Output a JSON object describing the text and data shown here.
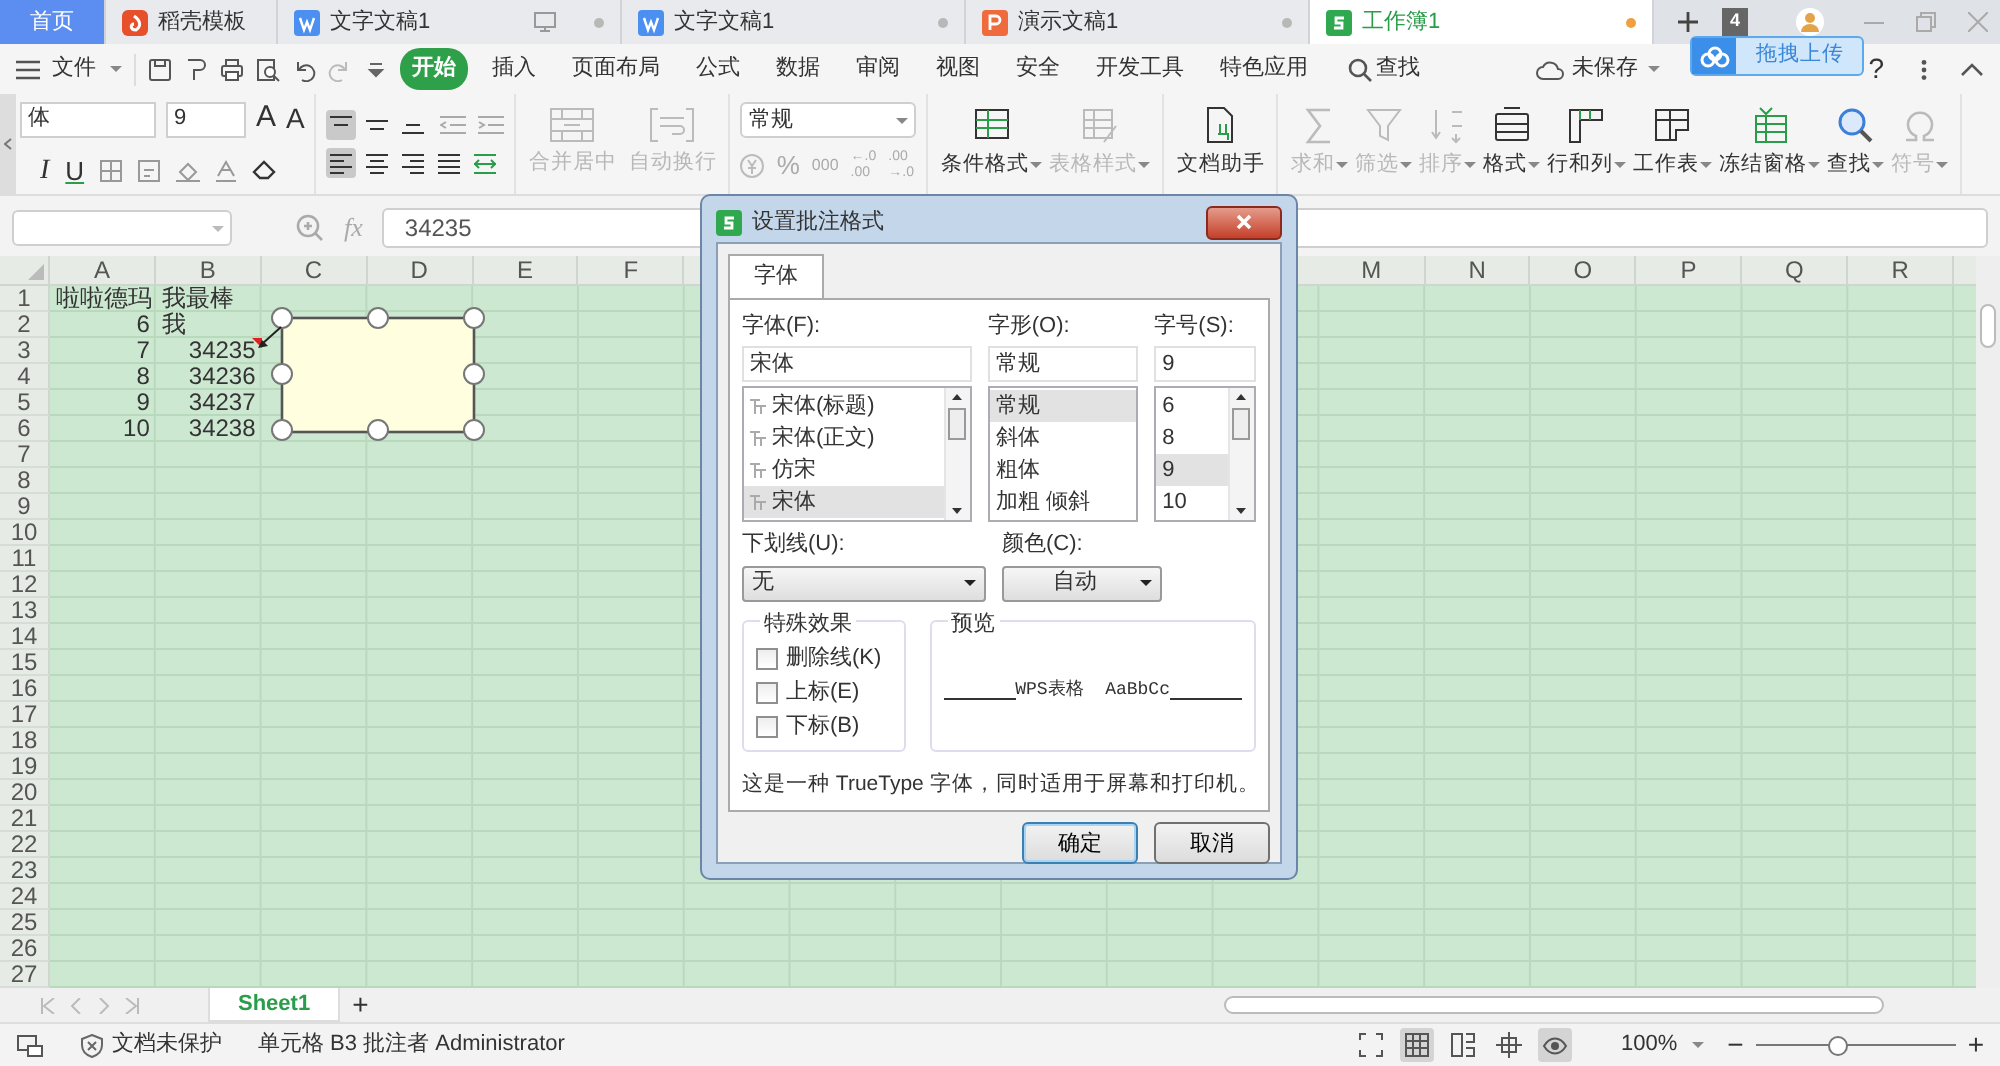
{
  "tabs": [
    {
      "label": "首页",
      "kind": "home",
      "selected": false
    },
    {
      "label": "稻壳模板",
      "kind": "docer",
      "selected": false
    },
    {
      "label": "文字文稿1",
      "kind": "writer",
      "selected": false,
      "color": "#b8b8b8"
    },
    {
      "label": "文字文稿1",
      "kind": "writer",
      "selected": false,
      "color": "#b8b8b8"
    },
    {
      "label": "演示文稿1",
      "kind": "presentation",
      "selected": false,
      "color": "#b8b8b8"
    },
    {
      "label": "工作簿1",
      "kind": "sheet",
      "selected": true,
      "color": "#f0a040"
    }
  ],
  "tab_count": "4",
  "upload_popup": "拖拽上传",
  "menu": {
    "file": "文件",
    "tabs": [
      {
        "label": "开始",
        "selected": true
      },
      {
        "label": "插入",
        "selected": false
      },
      {
        "label": "页面布局",
        "selected": false
      },
      {
        "label": "公式",
        "selected": false
      },
      {
        "label": "数据",
        "selected": false
      },
      {
        "label": "审阅",
        "selected": false
      },
      {
        "label": "视图",
        "selected": false
      },
      {
        "label": "安全",
        "selected": false
      },
      {
        "label": "开发工具",
        "selected": false
      },
      {
        "label": "特色应用",
        "selected": false
      }
    ],
    "search": "查找",
    "save_state": "未保存",
    "help": "?"
  },
  "ribbon": {
    "font_name": "体",
    "font_size": "9",
    "grow": "A",
    "shrink": "A",
    "italic": "I",
    "underline": "U",
    "vertical_align": [
      {
        "selected": true
      },
      {
        "selected": false
      },
      {
        "selected": false
      }
    ],
    "horizontal_align": [
      {
        "selected": true
      },
      {
        "selected": false
      },
      {
        "selected": false
      },
      {
        "selected": false
      },
      {
        "selected": false
      }
    ],
    "merge": {
      "label": "合并居中",
      "disabled": true
    },
    "wrap": {
      "label": "自动换行",
      "disabled": true
    },
    "number_format": "常规",
    "percent": "%",
    "thousands": "000",
    "decimals": [
      {
        "top": "←.0",
        "bottom": ".00"
      },
      {
        "top": ".00",
        "bottom": "→.0"
      }
    ],
    "big_buttons": [
      {
        "label": "条件格式",
        "disabled": false,
        "menu": true
      },
      {
        "label": "表格样式",
        "disabled": true,
        "menu": true
      },
      {
        "label": "文档助手",
        "disabled": false,
        "menu": false
      },
      {
        "label": "求和",
        "disabled": true,
        "menu": true
      },
      {
        "label": "筛选",
        "disabled": true,
        "menu": true
      },
      {
        "label": "排序",
        "disabled": true,
        "menu": true
      },
      {
        "label": "格式",
        "disabled": false,
        "menu": true
      },
      {
        "label": "行和列",
        "disabled": false,
        "menu": true
      },
      {
        "label": "工作表",
        "disabled": false,
        "menu": true
      },
      {
        "label": "冻结窗格",
        "disabled": false,
        "menu": true
      },
      {
        "label": "查找",
        "disabled": false,
        "menu": true
      },
      {
        "label": "符号",
        "disabled": true,
        "menu": true
      }
    ]
  },
  "formula_bar": {
    "fx": "fx",
    "value": "34235"
  },
  "columns_left": [
    "A",
    "B",
    "C",
    "D",
    "E",
    "F"
  ],
  "columns_right": [
    "M",
    "N",
    "O",
    "P",
    "Q",
    "R"
  ],
  "rows": [
    {
      "label": "1",
      "cells": [
        {
          "text": "啦啦德玛",
          "kind": "text"
        },
        {
          "text": "我最棒",
          "kind": "text"
        }
      ]
    },
    {
      "label": "2",
      "cells": [
        {
          "text": "6",
          "kind": "number"
        },
        {
          "text": "我",
          "kind": "text"
        }
      ]
    },
    {
      "label": "3",
      "cells": [
        {
          "text": "7",
          "kind": "number"
        },
        {
          "text": "34235",
          "kind": "number",
          "comment": true
        }
      ]
    },
    {
      "label": "4",
      "cells": [
        {
          "text": "8",
          "kind": "number"
        },
        {
          "text": "34236",
          "kind": "number"
        }
      ]
    },
    {
      "label": "5",
      "cells": [
        {
          "text": "9",
          "kind": "number"
        },
        {
          "text": "34237",
          "kind": "number"
        }
      ]
    },
    {
      "label": "6",
      "cells": [
        {
          "text": "10",
          "kind": "number"
        },
        {
          "text": "34238",
          "kind": "number"
        }
      ]
    },
    {
      "label": "7"
    },
    {
      "label": "8"
    },
    {
      "label": "9"
    },
    {
      "label": "10"
    },
    {
      "label": "11"
    },
    {
      "label": "12"
    },
    {
      "label": "13"
    },
    {
      "label": "14"
    },
    {
      "label": "15"
    },
    {
      "label": "16"
    },
    {
      "label": "17"
    },
    {
      "label": "18"
    },
    {
      "label": "19"
    },
    {
      "label": "20"
    },
    {
      "label": "21"
    },
    {
      "label": "22"
    },
    {
      "label": "23"
    },
    {
      "label": "24"
    },
    {
      "label": "25"
    },
    {
      "label": "26"
    },
    {
      "label": "27"
    }
  ],
  "sheets": [
    {
      "label": "Sheet1",
      "selected": true
    }
  ],
  "add_sheet": "+",
  "dialog": {
    "title": "设置批注格式",
    "tabs": [
      {
        "label": "字体",
        "selected": true
      }
    ],
    "font": {
      "label": "字体(F):",
      "value": "宋体",
      "options": [
        {
          "label": "宋体(标题)",
          "selected": false
        },
        {
          "label": "宋体(正文)",
          "selected": false
        },
        {
          "label": "仿宋",
          "selected": false
        },
        {
          "label": "宋体",
          "selected": true
        }
      ]
    },
    "style": {
      "label": "字形(O):",
      "value": "常规",
      "options": [
        {
          "label": "常规",
          "selected": true
        },
        {
          "label": "斜体",
          "selected": false
        },
        {
          "label": "粗体",
          "selected": false
        },
        {
          "label": "加粗 倾斜",
          "selected": false
        }
      ]
    },
    "size": {
      "label": "字号(S):",
      "value": "9",
      "options": [
        {
          "label": "6",
          "selected": false
        },
        {
          "label": "8",
          "selected": false
        },
        {
          "label": "9",
          "selected": true
        },
        {
          "label": "10",
          "selected": false
        }
      ]
    },
    "underline": {
      "label": "下划线(U):",
      "value": "无"
    },
    "color": {
      "label": "颜色(C):",
      "value": "自动"
    },
    "effects": {
      "title": "特殊效果",
      "items": [
        {
          "label": "删除线(K)",
          "checked": false
        },
        {
          "label": "上标(E)",
          "checked": false
        },
        {
          "label": "下标(B)",
          "checked": false
        }
      ]
    },
    "preview": {
      "title": "预览",
      "sample": "WPS表格  AaBbCc"
    },
    "note": "这是一种 TrueType 字体，同时适用于屏幕和打印机。",
    "buttons": [
      {
        "label": "确定",
        "primary": true
      },
      {
        "label": "取消",
        "primary": false
      }
    ]
  },
  "status": {
    "protect": "文档未保护",
    "info": "单元格 B3 批注者 Administrator",
    "zoom": "100%",
    "minus": "−",
    "plus": "+",
    "zoom_slider": {
      "level": 0.4
    }
  }
}
